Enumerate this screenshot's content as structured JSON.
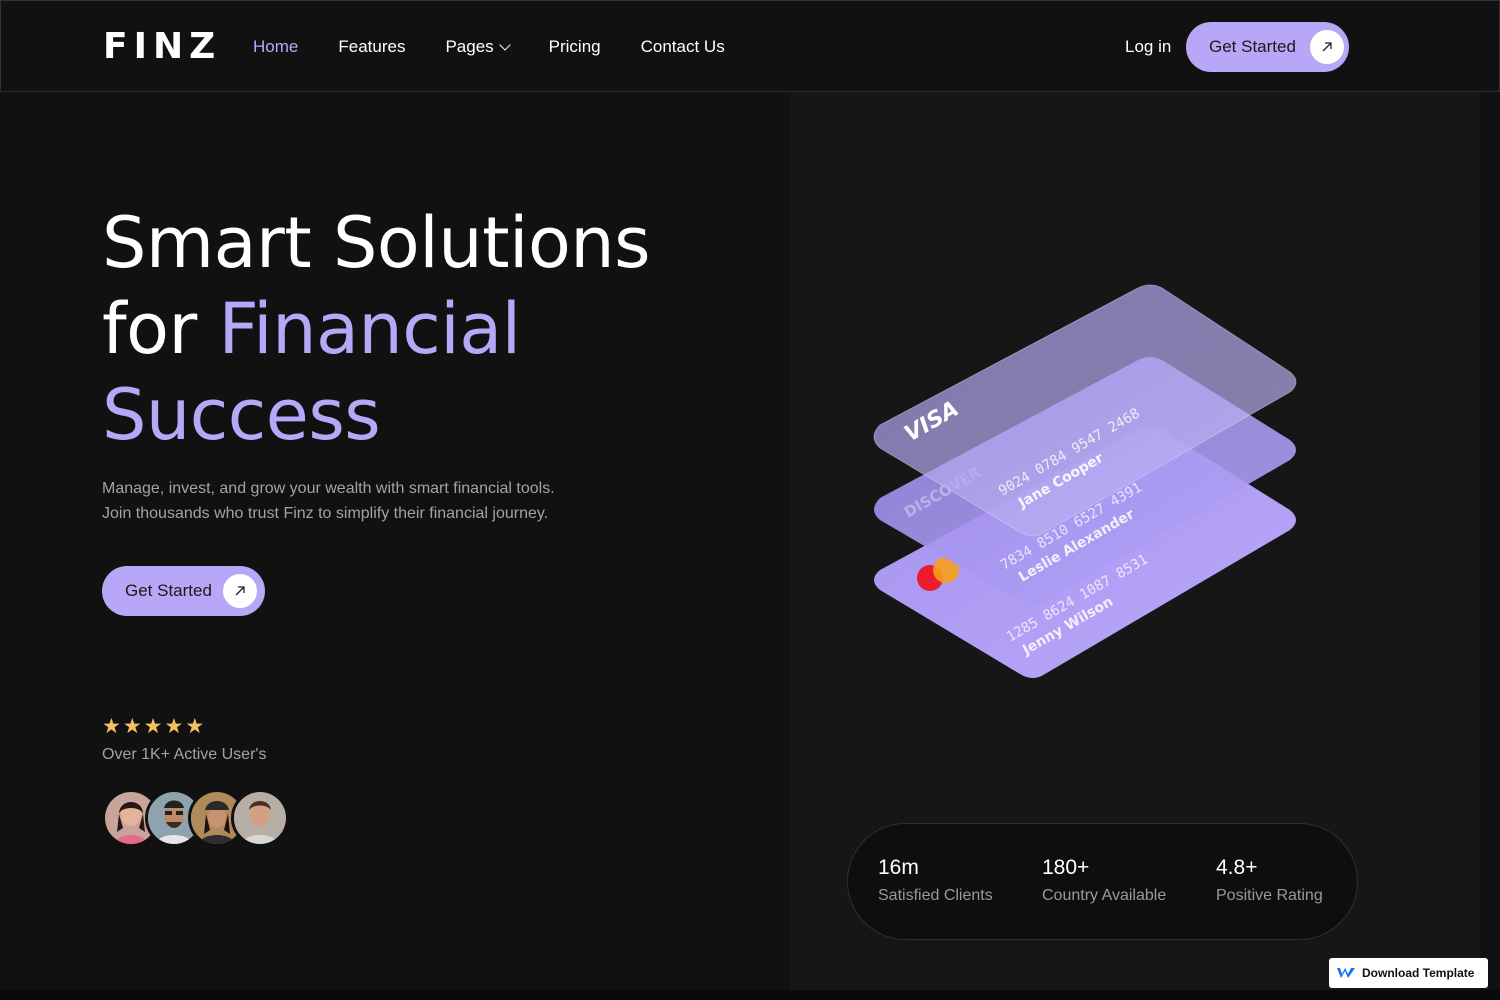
{
  "brand": {
    "logo_text": "FINZ",
    "accent_color": "#b8a6f7",
    "star_color": "#f4c063"
  },
  "nav": {
    "items": [
      {
        "label": "Home",
        "active": true
      },
      {
        "label": "Features"
      },
      {
        "label": "Pages",
        "has_dropdown": true
      },
      {
        "label": "Pricing"
      },
      {
        "label": "Contact Us"
      }
    ],
    "login_label": "Log in",
    "cta_label": "Get Started"
  },
  "hero": {
    "title_line1": "Smart Solutions",
    "title_for": "for ",
    "title_accent1": "Financial",
    "title_accent2": "Success",
    "description_line1": "Manage, invest, and grow your wealth with smart financial tools.",
    "description_line2": "Join thousands who trust Finz to simplify their financial journey.",
    "cta_label": "Get Started",
    "rating_stars": 5,
    "users_text": "Over 1K+ Active User's"
  },
  "cards": [
    {
      "brand": "VISA",
      "number": "9024  0784  9547  2468",
      "name": "Jane Cooper"
    },
    {
      "brand": "DISCOVER",
      "number": "7834  8510  6527  4391",
      "name": "Leslie Alexander"
    },
    {
      "brand": "mastercard-icon",
      "number": "1285  8624  1087  8531",
      "name": "Jenny Wilson"
    }
  ],
  "stats": [
    {
      "value": "16m",
      "label": "Satisfied Clients"
    },
    {
      "value": "180+",
      "label": "Country Available"
    },
    {
      "value": "4.8+",
      "label": "Positive Rating"
    }
  ],
  "badge": {
    "label": "Download Template"
  }
}
